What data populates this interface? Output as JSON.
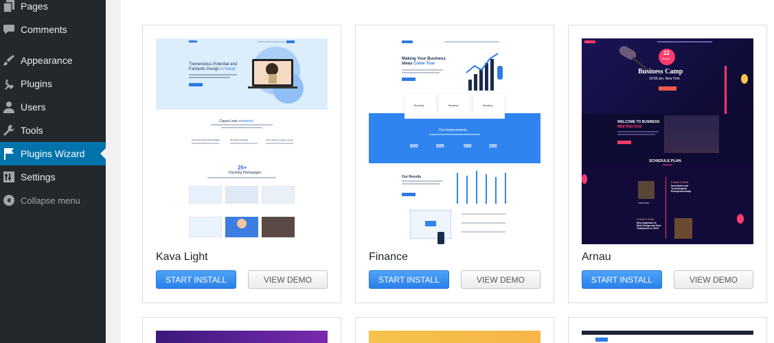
{
  "sidebar": {
    "items": [
      {
        "label": "Pages",
        "icon": "pages-icon"
      },
      {
        "label": "Comments",
        "icon": "comments-icon"
      },
      {
        "label": "Appearance",
        "icon": "appearance-icon"
      },
      {
        "label": "Plugins",
        "icon": "plugins-icon"
      },
      {
        "label": "Users",
        "icon": "users-icon"
      },
      {
        "label": "Tools",
        "icon": "tools-icon"
      },
      {
        "label": "Plugins Wizard",
        "icon": "flag-icon",
        "active": true
      },
      {
        "label": "Settings",
        "icon": "settings-icon"
      },
      {
        "label": "Collapse menu",
        "icon": "collapse-icon"
      }
    ],
    "active_color": "#0073aa",
    "bg_color": "#23282d"
  },
  "templates": [
    {
      "title": "Kava Light",
      "install_label": "START INSTALL",
      "demo_label": "VIEW DEMO",
      "preview": {
        "hero_title_1": "Tremendous Potential and",
        "hero_title_2": "Fantastic Design",
        "hero_title_accent": "is Kava!",
        "section_title": "Classic look",
        "section_accent": "wonderful",
        "features": [
          "Drag & Drop Elementor Builder",
          "All Plugins Package",
          "Great Variety of Page Layouts"
        ],
        "count": "26+",
        "count_label": "Dazzling Homepages"
      }
    },
    {
      "title": "Finance",
      "install_label": "START INSTALL",
      "demo_label": "VIEW DEMO",
      "preview": {
        "hero_line_1": "Making Your Business",
        "hero_line_2": "Ideas",
        "hero_accent": "Come True",
        "features": [
          "Branding",
          "Branding",
          "Branding"
        ],
        "achievements_title": "Our Achievements",
        "stats": [
          "600",
          "585",
          "580",
          "280"
        ],
        "results_title": "Our Results"
      }
    },
    {
      "title": "Arnau",
      "install_label": "START INSTALL",
      "demo_label": "VIEW DEMO",
      "preview": {
        "date_day": "22",
        "date_month": "March",
        "event_title": "Business Camp",
        "event_time": "10:00 am, New York",
        "welcome_1": "WELCOME TO BUSINESS",
        "welcome_2": "MEETING 2019",
        "schedule_title": "SCHEDULE PLAN",
        "speaker_1": "TOM FORD",
        "time_1": "8:30AM-9:30AM",
        "session_1a": "Innovation and",
        "session_1b": "Technological",
        "session_1c": "Entrepreneurship",
        "time_2": "8:30AM-9:30AM",
        "session_2a": "New Approach to",
        "session_2b": "Web Design and New",
        "session_2c": "Tendencies in 2019"
      }
    }
  ]
}
